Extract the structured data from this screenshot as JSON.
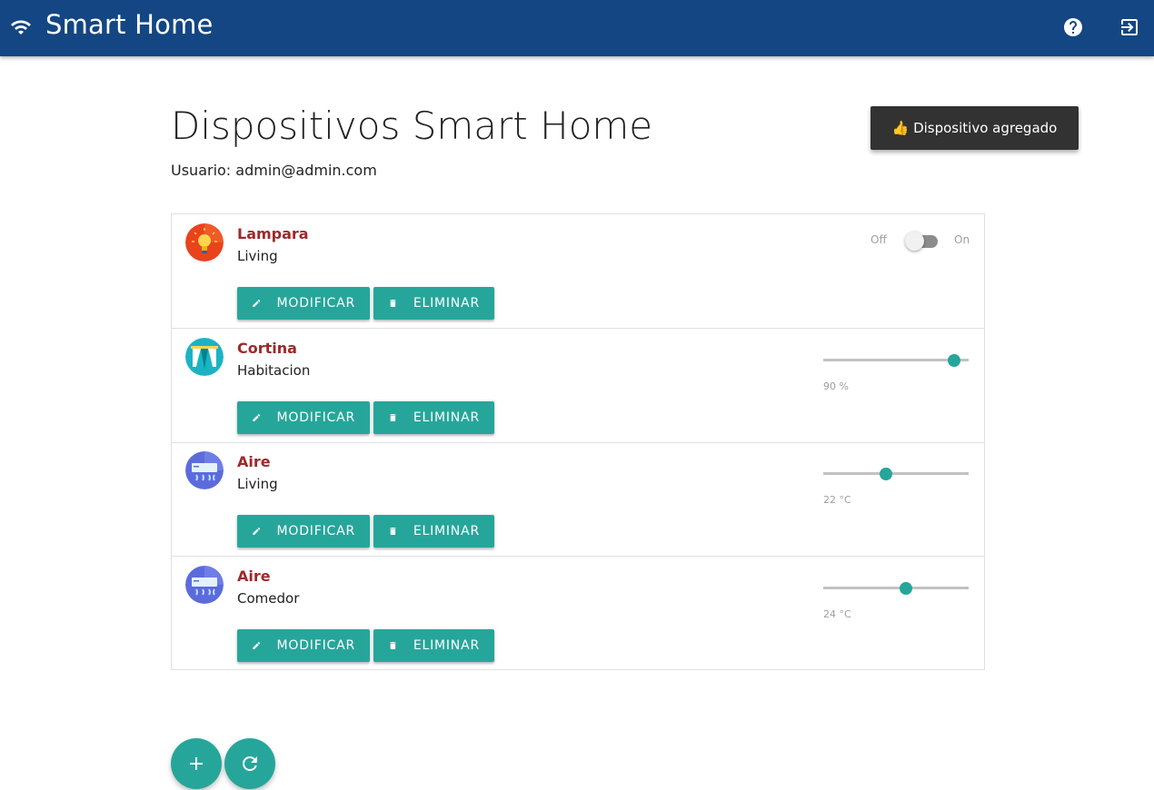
{
  "app": {
    "title": "Smart Home",
    "brand_color": "#134682",
    "accent_color": "#26a69a",
    "icons": [
      "wifi-icon",
      "help-icon",
      "logout-icon"
    ]
  },
  "header": {
    "title": "Dispositivos Smart Home",
    "user_line": "Usuario: admin@admin.com"
  },
  "toast": {
    "text": "👍 Dispositivo agregado"
  },
  "buttons": {
    "modify_label": "MODIFICAR",
    "delete_label": "ELIMINAR",
    "modify_icon": "pencil-icon",
    "delete_icon": "trash-icon"
  },
  "devices": [
    {
      "name": "Lampara",
      "room": "Living",
      "icon": "lightbulb-icon",
      "control": "switch",
      "switch_off_label": "Off",
      "switch_on_label": "On",
      "state": "off"
    },
    {
      "name": "Cortina",
      "room": "Habitacion",
      "icon": "curtain-icon",
      "control": "slider",
      "value": 90,
      "min": 0,
      "max": 100,
      "value_label": "90 %"
    },
    {
      "name": "Aire",
      "room": "Living",
      "icon": "air-conditioner-icon",
      "control": "slider",
      "value": 22,
      "min": 16,
      "max": 30,
      "value_label": "22 °C"
    },
    {
      "name": "Aire",
      "room": "Comedor",
      "icon": "air-conditioner-icon",
      "control": "slider",
      "value": 24,
      "min": 16,
      "max": 30,
      "value_label": "24 °C"
    }
  ],
  "fabs": {
    "add_icon": "plus-icon",
    "refresh_icon": "refresh-icon"
  }
}
